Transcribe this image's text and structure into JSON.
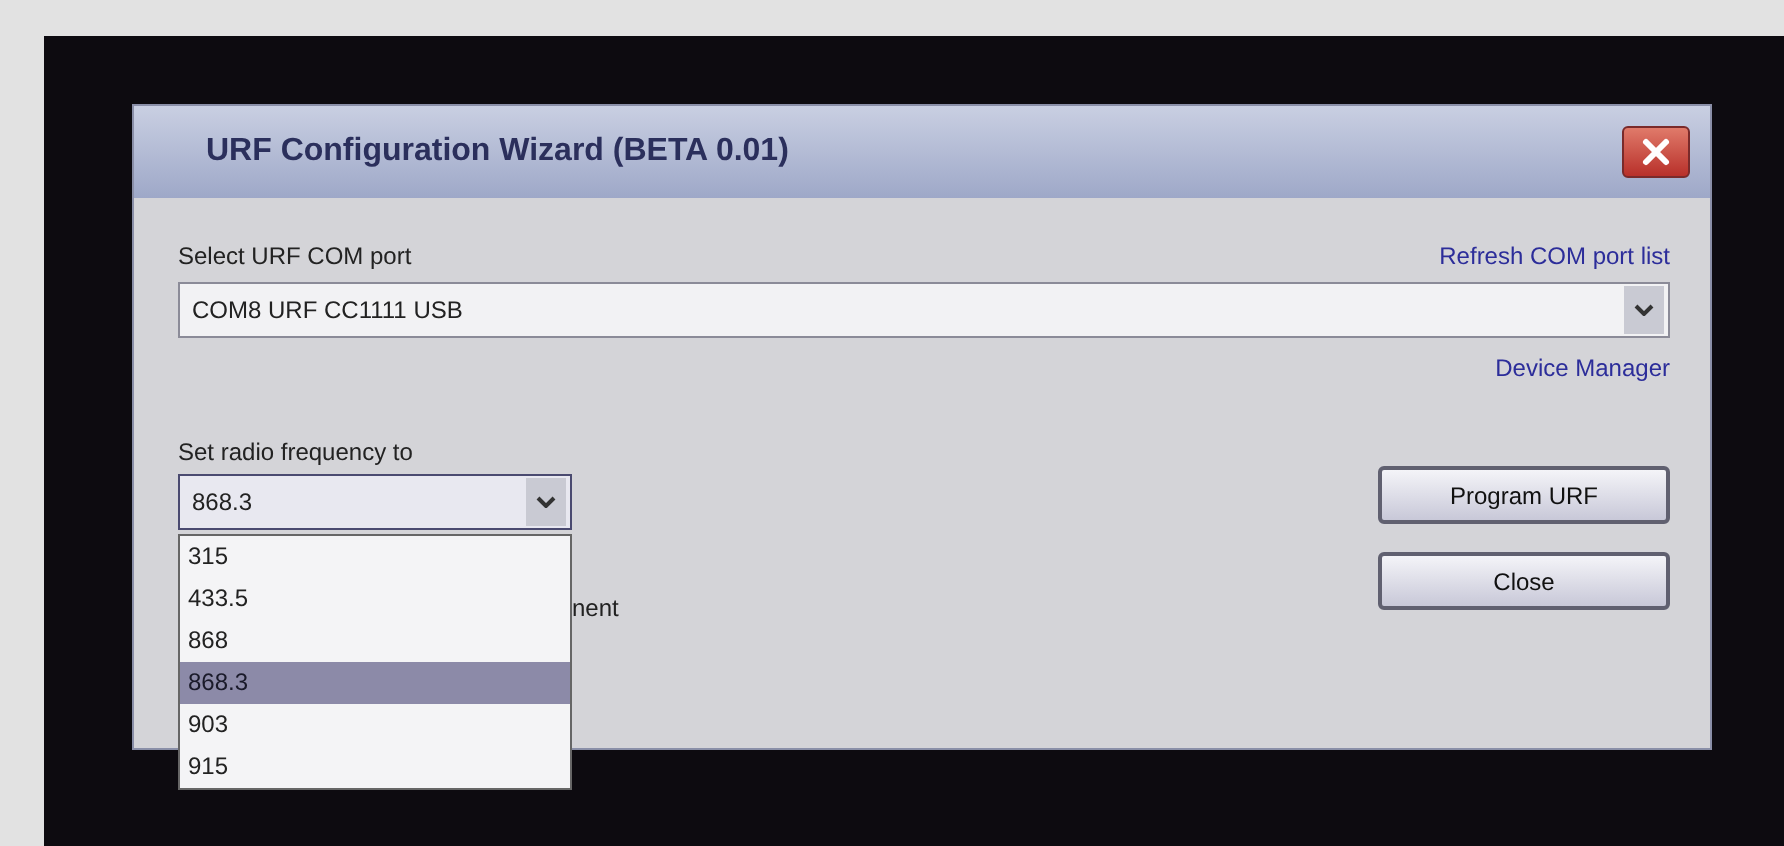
{
  "window": {
    "title": "URF Configuration Wizard (BETA 0.01)"
  },
  "com_port": {
    "label": "Select URF COM port",
    "refresh_link": "Refresh COM port list",
    "value": "COM8 URF CC1111 USB",
    "device_manager_link": "Device Manager"
  },
  "frequency": {
    "label": "Set radio frequency to",
    "value": "868.3",
    "expanded": true,
    "options": [
      {
        "label": "315",
        "selected": false
      },
      {
        "label": "433.5",
        "selected": false
      },
      {
        "label": "868",
        "selected": false
      },
      {
        "label": "868.3",
        "selected": true
      },
      {
        "label": "903",
        "selected": false
      },
      {
        "label": "915",
        "selected": false
      }
    ]
  },
  "partial_label": "nent",
  "buttons": [
    "Program URF",
    "Close"
  ]
}
